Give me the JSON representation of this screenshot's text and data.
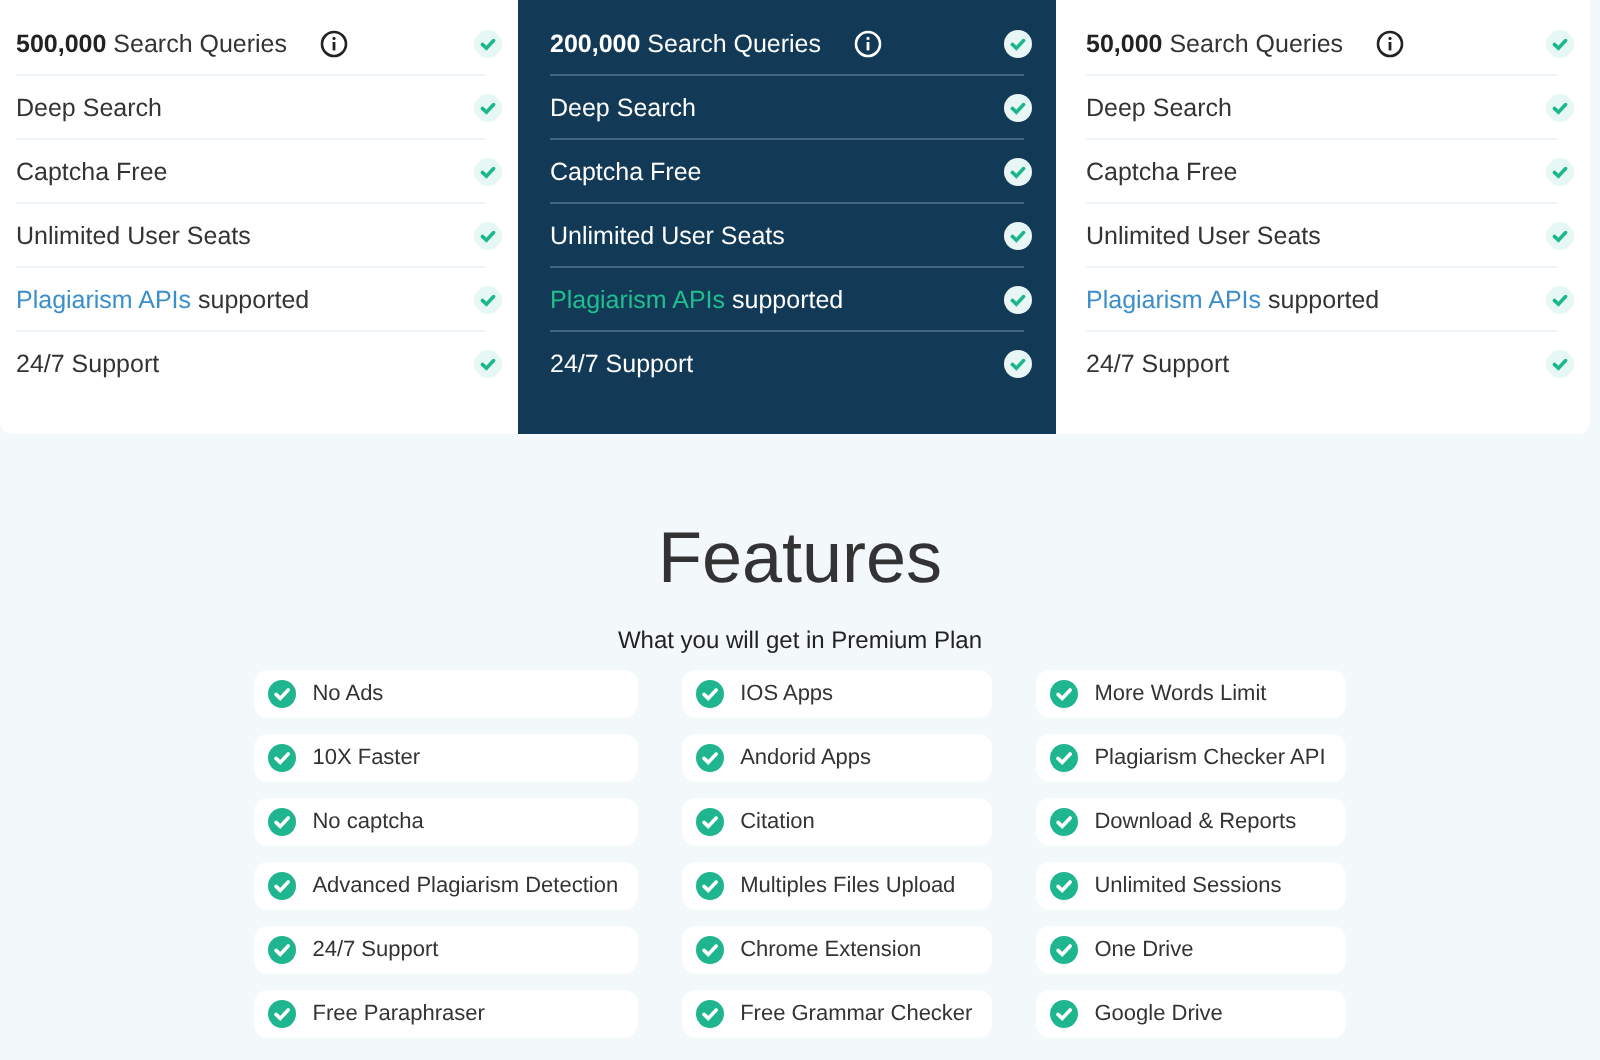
{
  "plans": [
    {
      "highlighted": false,
      "items": [
        {
          "kind": "info",
          "text": "**500,000** Search Queries"
        },
        {
          "kind": "plain",
          "text": "Deep Search"
        },
        {
          "kind": "plain",
          "text": "Captcha Free"
        },
        {
          "kind": "plain",
          "text": "Unlimited User Seats"
        },
        {
          "kind": "link",
          "link": "Plagiarism APIs",
          "text": "supported"
        },
        {
          "kind": "plain",
          "text": "24/7 Support"
        }
      ]
    },
    {
      "highlighted": true,
      "items": [
        {
          "kind": "info",
          "text": "**200,000** Search Queries"
        },
        {
          "kind": "plain",
          "text": "Deep Search"
        },
        {
          "kind": "plain",
          "text": "Captcha Free"
        },
        {
          "kind": "plain",
          "text": "Unlimited User Seats"
        },
        {
          "kind": "link",
          "link": "Plagiarism APIs",
          "text": "supported"
        },
        {
          "kind": "plain",
          "text": "24/7 Support"
        }
      ]
    },
    {
      "highlighted": false,
      "items": [
        {
          "kind": "info",
          "text": "**50,000** Search Queries"
        },
        {
          "kind": "plain",
          "text": "Deep Search"
        },
        {
          "kind": "plain",
          "text": "Captcha Free"
        },
        {
          "kind": "plain",
          "text": "Unlimited User Seats"
        },
        {
          "kind": "link",
          "link": "Plagiarism APIs",
          "text": "supported"
        },
        {
          "kind": "plain",
          "text": "24/7 Support"
        }
      ]
    }
  ],
  "features": {
    "title": "Features",
    "subtitle": "What you will get in Premium Plan",
    "columns": [
      [
        "No Ads",
        "10X Faster",
        "No captcha",
        "Advanced Plagiarism Detection",
        "24/7 Support",
        "Free Paraphraser"
      ],
      [
        "IOS Apps",
        "Andorid Apps",
        "Citation",
        "Multiples Files Upload",
        "Chrome Extension",
        "Free Grammar Checker"
      ],
      [
        "More Words Limit",
        "Plagiarism Checker API",
        "Download & Reports",
        "Unlimited Sessions",
        "One Drive",
        "Google Drive"
      ]
    ]
  }
}
